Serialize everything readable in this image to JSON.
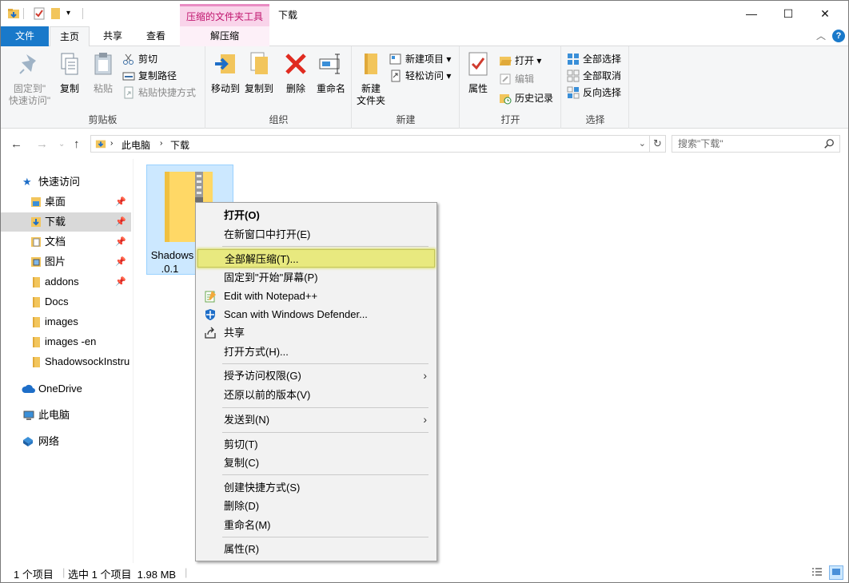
{
  "window": {
    "title": "下载",
    "contextual_tab_title": "压缩的文件夹工具",
    "controls": {
      "minimize": "—",
      "maximize": "☐",
      "close": "✕"
    }
  },
  "ribbon_tabs": {
    "file": "文件",
    "home": "主页",
    "share": "共享",
    "view": "查看",
    "extract": "解压缩"
  },
  "ribbon": {
    "clipboard": {
      "label": "剪贴板",
      "pin": "固定到\"\n快速访问\"",
      "copy": "复制",
      "paste": "粘贴",
      "cut": "剪切",
      "copy_path": "复制路径",
      "paste_shortcut": "粘贴快捷方式"
    },
    "organize": {
      "label": "组织",
      "move_to": "移动到",
      "copy_to": "复制到",
      "delete": "删除",
      "rename": "重命名"
    },
    "new": {
      "label": "新建",
      "new_folder": "新建\n文件夹",
      "new_item": "新建项目",
      "easy_access": "轻松访问"
    },
    "open": {
      "label": "打开",
      "properties": "属性",
      "open": "打开",
      "edit": "编辑",
      "history": "历史记录"
    },
    "select": {
      "label": "选择",
      "select_all": "全部选择",
      "select_none": "全部取消",
      "invert": "反向选择"
    }
  },
  "address": {
    "crumb1": "此电脑",
    "crumb2": "下载",
    "search_placeholder": "搜索\"下载\""
  },
  "nav": {
    "quick_access": "快速访问",
    "items": [
      {
        "label": "桌面",
        "pinned": true
      },
      {
        "label": "下载",
        "pinned": true
      },
      {
        "label": "文档",
        "pinned": true
      },
      {
        "label": "图片",
        "pinned": true
      },
      {
        "label": "addons",
        "pinned": true
      },
      {
        "label": "Docs",
        "pinned": false
      },
      {
        "label": "images",
        "pinned": false
      },
      {
        "label": "images -en",
        "pinned": false
      },
      {
        "label": "ShadowsockInstru",
        "pinned": false
      }
    ],
    "onedrive": "OneDrive",
    "this_pc": "此电脑",
    "network": "网络"
  },
  "content": {
    "file_name_line1": "Shadows",
    "file_name_line2": ".0.1"
  },
  "context_menu": {
    "open": "打开(O)",
    "open_new_window": "在新窗口中打开(E)",
    "extract_all": "全部解压缩(T)...",
    "pin_start": "固定到\"开始\"屏幕(P)",
    "edit_notepad": "Edit with Notepad++",
    "scan_defender": "Scan with Windows Defender...",
    "share": "共享",
    "open_with": "打开方式(H)...",
    "give_access": "授予访问权限(G)",
    "restore_versions": "还原以前的版本(V)",
    "send_to": "发送到(N)",
    "cut": "剪切(T)",
    "copy": "复制(C)",
    "create_shortcut": "创建快捷方式(S)",
    "delete": "删除(D)",
    "rename": "重命名(M)",
    "properties": "属性(R)"
  },
  "status": {
    "item_count": "1 个项目",
    "selected": "选中 1 个项目  1.98 MB"
  },
  "colors": {
    "accent": "#1979ca",
    "contextual_tab": "#f9d4ea",
    "highlight": "#e8e97f",
    "selection": "#cce8ff",
    "folder": "#ffd866"
  }
}
